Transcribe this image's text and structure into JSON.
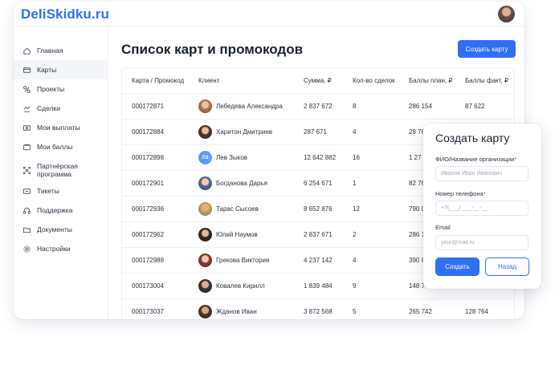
{
  "app": {
    "logo": "DeliSkidku.ru"
  },
  "sidebar": {
    "items": [
      {
        "label": "Главная",
        "icon": "home-icon"
      },
      {
        "label": "Карты",
        "icon": "card-icon",
        "active": true
      },
      {
        "label": "Проекты",
        "icon": "projects-icon"
      },
      {
        "label": "Сделки",
        "icon": "deals-icon"
      },
      {
        "label": "Мои выплаты",
        "icon": "payouts-icon"
      },
      {
        "label": "Мои баллы",
        "icon": "points-icon"
      },
      {
        "label": "Партнёрская\nпрограмма",
        "icon": "partner-icon"
      },
      {
        "label": "Тикеты",
        "icon": "ticket-icon"
      },
      {
        "label": "Поддержка",
        "icon": "headset-icon"
      },
      {
        "label": "Документы",
        "icon": "folder-icon"
      },
      {
        "label": "Настройки",
        "icon": "gear-icon"
      }
    ]
  },
  "main": {
    "title": "Список карт и промокодов",
    "create_button": "Создать карту"
  },
  "table": {
    "headers": [
      "Карта / Промокод",
      "Клиент",
      "Сумма, ₽",
      "Кол-во сделок",
      "Баллы план, ₽",
      "Баллы факт, ₽"
    ],
    "rows": [
      {
        "card": "000172871",
        "client": "Лебедева Александра",
        "sum": "2 837 672",
        "deals": "8",
        "plan": "286 154",
        "fact": "87 622",
        "avatar": "photo"
      },
      {
        "card": "000172884",
        "client": "Харитон Дмитриев",
        "sum": "287 671",
        "deals": "4",
        "plan": "28 76",
        "fact": "",
        "avatar": "photo"
      },
      {
        "card": "000172898",
        "client": "Лев Зыков",
        "sum": "12 642 882",
        "deals": "16",
        "plan": "1 27",
        "fact": "",
        "avatar": "initials",
        "initials": "ЛЗ"
      },
      {
        "card": "000172901",
        "client": "Богданова Дарья",
        "sum": "6 254 671",
        "deals": "1",
        "plan": "82 76",
        "fact": "",
        "avatar": "photo"
      },
      {
        "card": "000172936",
        "client": "Тарас Сысоев",
        "sum": "8 652 876",
        "deals": "12",
        "plan": "790 0",
        "fact": "",
        "avatar": "photo"
      },
      {
        "card": "000172962",
        "client": "Юлий Наумов",
        "sum": "2 837 671",
        "deals": "2",
        "plan": "286 1",
        "fact": "",
        "avatar": "photo"
      },
      {
        "card": "000172988",
        "client": "Грекова Виктория",
        "sum": "4 237 142",
        "deals": "4",
        "plan": "390 8",
        "fact": "",
        "avatar": "photo"
      },
      {
        "card": "000173004",
        "client": "Ковалев Кирилл",
        "sum": "1 839 484",
        "deals": "9",
        "plan": "148 7",
        "fact": "",
        "avatar": "photo"
      },
      {
        "card": "000173037",
        "client": "Жданов Иван",
        "sum": "3 872 568",
        "deals": "5",
        "plan": "265 742",
        "fact": "128 764",
        "avatar": "photo"
      }
    ]
  },
  "modal": {
    "title": "Создать карту",
    "name_label": "ФИО/Название организации",
    "name_placeholder": "Иванов Иван Иванович",
    "phone_label": "Номер телефона",
    "phone_placeholder": "+7(___) ___-__-__",
    "email_label": "Email",
    "email_placeholder": "your@mail.ru",
    "required_mark": "*",
    "submit": "Создать",
    "back": "Назад"
  },
  "colors": {
    "accent": "#2f6ff3",
    "required": "#e53935"
  }
}
